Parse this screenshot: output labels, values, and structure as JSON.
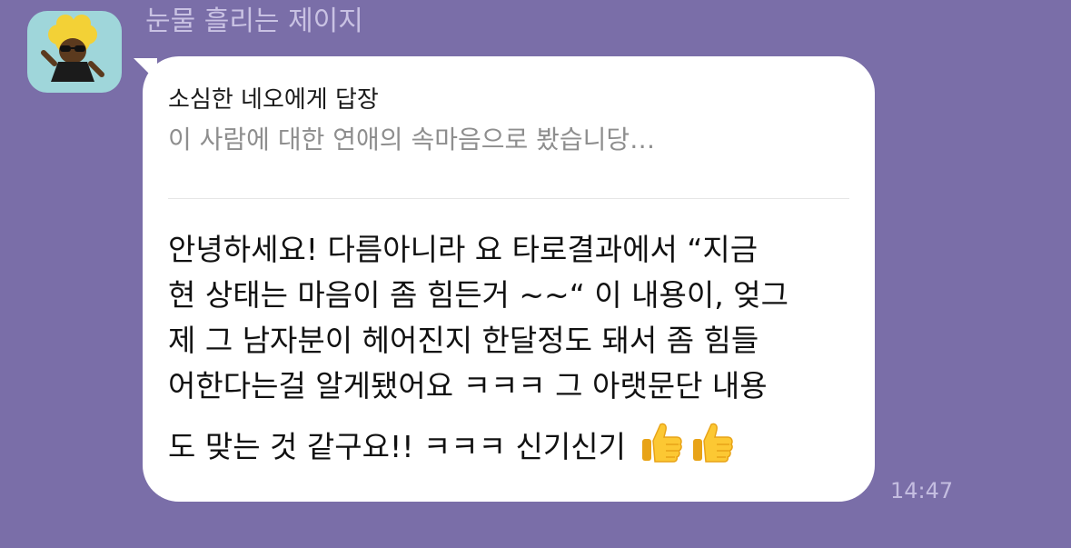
{
  "chat": {
    "sender_name": "눈물 흘리는 제이지",
    "avatar_icon": "jay-g-character-avatar",
    "background_color": "#7a6ea8",
    "bubble_color": "#ffffff",
    "reply": {
      "target": "소심한 네오에게 답장",
      "preview": "이 사람에 대한 연애의 속마음으로 봤습니당…"
    },
    "message_lines": [
      "안녕하세요! 다름아니라 요 타로결과에서 “지금",
      "현 상태는 마음이 좀 힘든거 ~~“ 이 내용이, 엊그",
      "제 그 남자분이 헤어진지 한달정도 돼서 좀 힘들",
      "어한다는걸 알게됐어요 ㅋㅋㅋ 그 아랫문단 내용",
      "도 맞는 것 같구요!! ㅋㅋㅋ 신기신기"
    ],
    "emoji_icons": [
      "thumbs-up-icon",
      "thumbs-up-icon"
    ],
    "timestamp": "14:47"
  }
}
